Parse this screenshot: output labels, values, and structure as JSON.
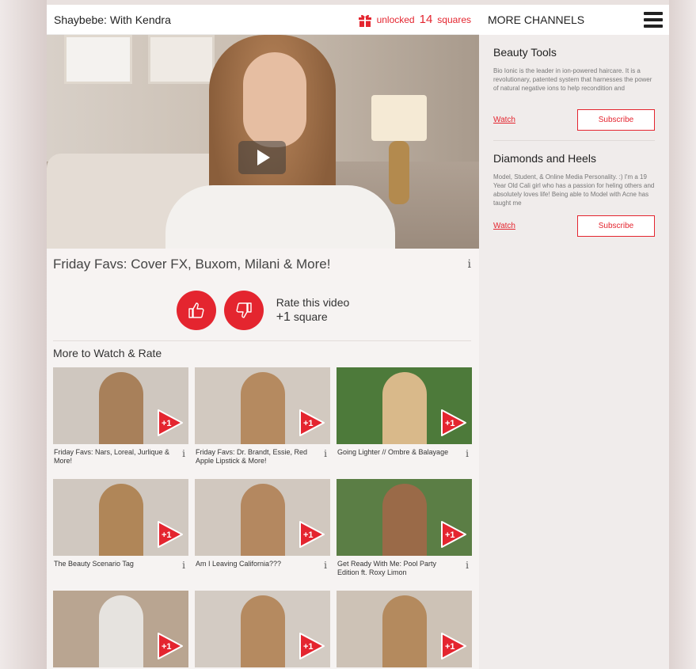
{
  "header": {
    "channel_title": "Shaybebe: With Kendra",
    "unlocked_prefix": "unlocked",
    "unlocked_count": "14",
    "unlocked_suffix": "squares"
  },
  "video": {
    "title": "Friday Favs: Cover FX, Buxom, Milani & More!",
    "info": "i"
  },
  "rate": {
    "line1": "Rate this video",
    "plus": "+1",
    "unit": "square"
  },
  "more": {
    "title": "More to Watch & Rate",
    "badge": "+1",
    "items": [
      {
        "title": "Friday Favs: Nars, Loreal, Jurlique & More!",
        "info": "i",
        "bg": "#cfc7bf",
        "person": "#a8805a"
      },
      {
        "title": "Friday Favs: Dr. Brandt, Essie, Red Apple Lipstick & More!",
        "info": "i",
        "bg": "#d2c9c0",
        "person": "#b58a60"
      },
      {
        "title": "Going Lighter // Ombre & Balayage",
        "info": "i",
        "bg": "#4d7a3a",
        "person": "#d9b98a"
      },
      {
        "title": "The Beauty Scenario Tag",
        "info": "i",
        "bg": "#d0c8c0",
        "person": "#b08658"
      },
      {
        "title": "Am I Leaving California???",
        "info": "i",
        "bg": "#d1c8bf",
        "person": "#b48860"
      },
      {
        "title": "Get Ready With Me: Pool Party Edition ft. Roxy Limon",
        "info": "i",
        "bg": "#5b7e45",
        "person": "#9a6a48"
      },
      {
        "title": "",
        "info": "",
        "bg": "#b9a591",
        "person": "#e6e3df"
      },
      {
        "title": "",
        "info": "",
        "bg": "#d3cbc3",
        "person": "#b58a60"
      },
      {
        "title": "",
        "info": "",
        "bg": "#cdc2b6",
        "person": "#b48a5e"
      }
    ]
  },
  "sidebar": {
    "title": "MORE CHANNELS",
    "channels": [
      {
        "name": "Beauty Tools",
        "desc": "Bio Ionic is the leader in ion-powered haircare. It is a revolutionary, patented system that harnesses the power of natural negative ions to help recondition and",
        "watch": "Watch",
        "subscribe": "Subscribe"
      },
      {
        "name": "Diamonds and Heels",
        "desc": "Model, Student, & Online Media Personality. :) I'm a 19 Year Old Cali girl who has a passion for heling others and absolutely loves life! Being able to Model with Acne has taught me",
        "watch": "Watch",
        "subscribe": "Subscribe"
      }
    ]
  },
  "colors": {
    "accent": "#e4252f"
  }
}
